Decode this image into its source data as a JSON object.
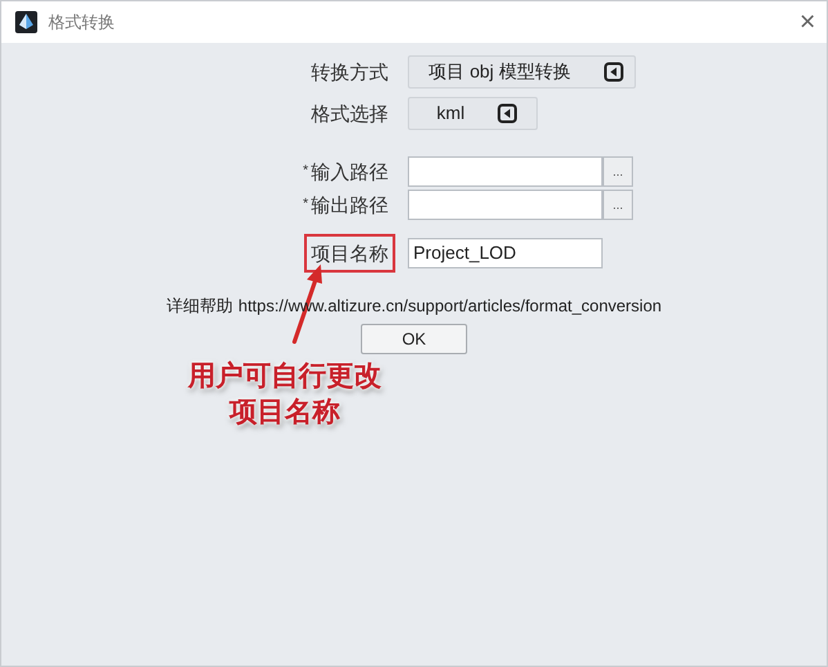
{
  "window": {
    "title": "格式转换",
    "close": "×"
  },
  "fields": [
    {
      "kind": "select",
      "label": "转换方式",
      "value": "项目 obj 模型转换",
      "required": false,
      "highlighted": false,
      "wide": true
    },
    {
      "kind": "select",
      "label": "格式选择",
      "value": "kml",
      "required": false,
      "highlighted": false,
      "wide": false
    },
    {
      "kind": "path",
      "label": "输入路径",
      "required": true,
      "highlighted": false,
      "browse": "..."
    },
    {
      "kind": "path",
      "label": "输出路径",
      "required": true,
      "highlighted": false,
      "browse": "..."
    },
    {
      "kind": "text",
      "label": "项目名称",
      "value": "Project_LOD",
      "required": false,
      "highlighted": true
    }
  ],
  "required_mark": "*",
  "help": {
    "label": "详细帮助",
    "link": "https://www.altizure.cn/support/articles/format_conversion"
  },
  "ok_button": "OK",
  "annotation": {
    "lines": [
      "用户可自行更改",
      "项目名称"
    ]
  }
}
